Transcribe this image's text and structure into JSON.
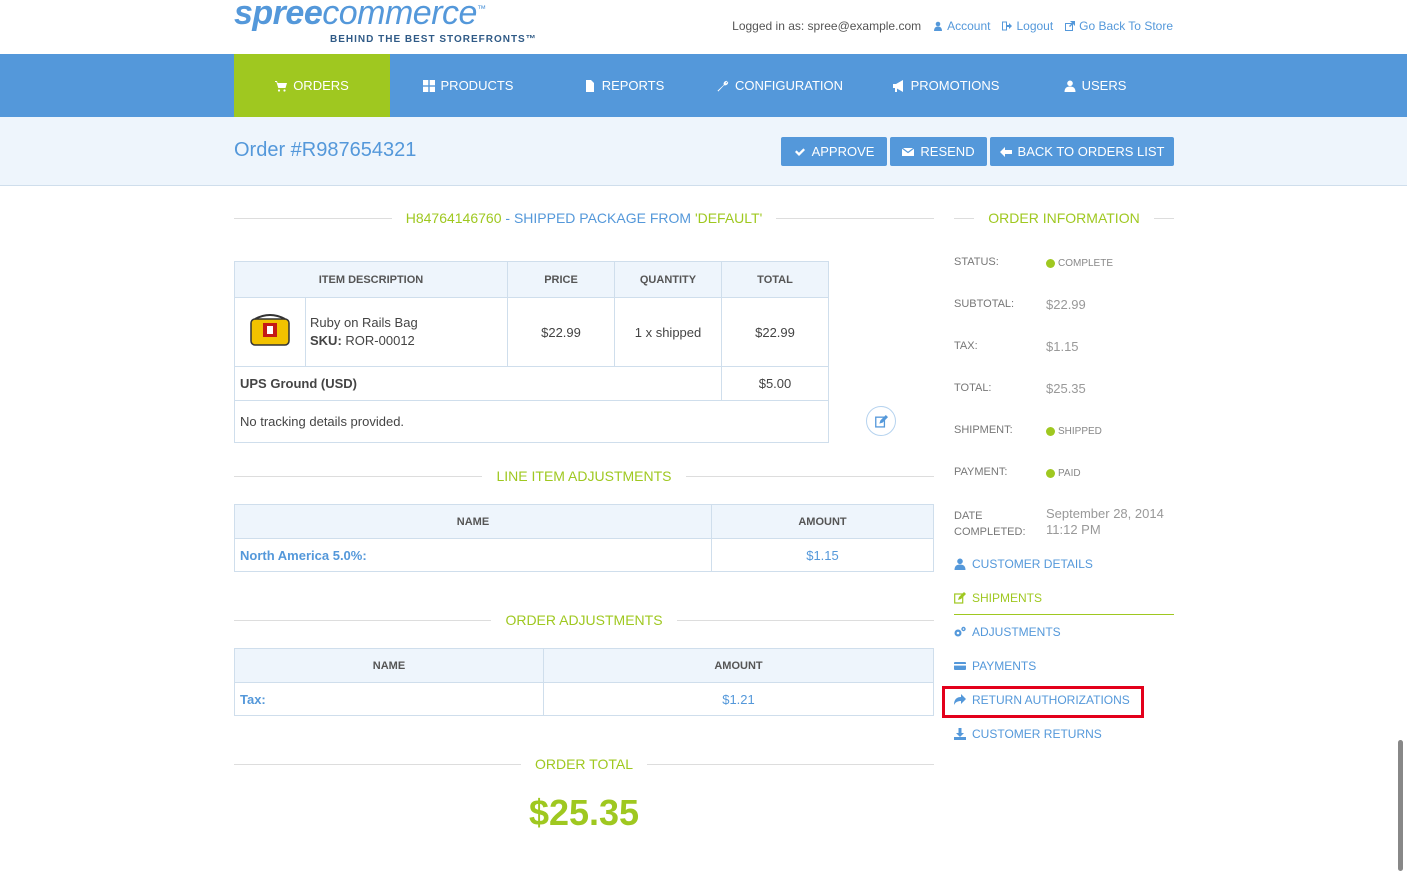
{
  "header": {
    "logo_spree": "spree",
    "logo_commerce": "commerce",
    "logo_tm": "™",
    "logo_tagline": "BEHIND THE BEST STOREFRONTS™",
    "logged_in_as": "Logged in as: spree@example.com",
    "account": "Account",
    "logout": "Logout",
    "back_to_store": "Go Back To Store"
  },
  "nav": {
    "items": [
      {
        "label": "ORDERS",
        "icon": "cart-icon",
        "active": true
      },
      {
        "label": "PRODUCTS",
        "icon": "grid-icon"
      },
      {
        "label": "REPORTS",
        "icon": "file-icon"
      },
      {
        "label": "CONFIGURATION",
        "icon": "wrench-icon"
      },
      {
        "label": "PROMOTIONS",
        "icon": "bullhorn-icon"
      },
      {
        "label": "USERS",
        "icon": "user-icon"
      }
    ]
  },
  "page": {
    "title": "Order #R987654321",
    "buttons": {
      "approve": "APPROVE",
      "resend": "RESEND",
      "back": "BACK TO ORDERS LIST"
    }
  },
  "shipment": {
    "tracking_number": "H84764146760",
    "title_middle": " - SHIPPED PACKAGE FROM ",
    "stock_location": "'DEFAULT'",
    "headers": [
      "ITEM DESCRIPTION",
      "PRICE",
      "QUANTITY",
      "TOTAL"
    ],
    "item": {
      "name": "Ruby on Rails Bag",
      "sku_label": "SKU:",
      "sku": "ROR-00012",
      "price": "$22.99",
      "quantity": "1 x shipped",
      "total": "$22.99"
    },
    "shipping_method": "UPS Ground (USD)",
    "shipping_cost": "$5.00",
    "tracking": "No tracking details provided."
  },
  "line_item_adjustments": {
    "title": "LINE ITEM ADJUSTMENTS",
    "headers": [
      "NAME",
      "AMOUNT"
    ],
    "rows": [
      {
        "name": "North America 5.0%:",
        "amount": "$1.15"
      }
    ]
  },
  "order_adjustments": {
    "title": "ORDER ADJUSTMENTS",
    "headers": [
      "NAME",
      "AMOUNT"
    ],
    "rows": [
      {
        "name": "Tax:",
        "amount": "$1.21"
      }
    ]
  },
  "order_total": {
    "title": "ORDER TOTAL",
    "value": "$25.35"
  },
  "order_info": {
    "title": "ORDER INFORMATION",
    "status_label": "STATUS:",
    "status": "COMPLETE",
    "subtotal_label": "SUBTOTAL:",
    "subtotal": "$22.99",
    "tax_label": "TAX:",
    "tax": "$1.15",
    "total_label": "TOTAL:",
    "total": "$25.35",
    "shipment_label": "SHIPMENT:",
    "shipment": "SHIPPED",
    "payment_label": "PAYMENT:",
    "payment": "PAID",
    "date_label_1": "DATE",
    "date_label_2": "COMPLETED:",
    "date_1": "September 28, 2014",
    "date_2": "11:12 PM"
  },
  "side_links": [
    {
      "label": "CUSTOMER DETAILS",
      "icon": "user-icon"
    },
    {
      "label": "SHIPMENTS",
      "icon": "edit-icon",
      "active": true
    },
    {
      "label": "ADJUSTMENTS",
      "icon": "cogs-icon"
    },
    {
      "label": "PAYMENTS",
      "icon": "credit-card-icon"
    },
    {
      "label": "RETURN AUTHORIZATIONS",
      "icon": "share-icon",
      "highlighted": true
    },
    {
      "label": "CUSTOMER RETURNS",
      "icon": "download-icon"
    }
  ],
  "colors": {
    "primary": "#5498da",
    "accent": "#9fc820",
    "highlight": "#e3001b"
  }
}
